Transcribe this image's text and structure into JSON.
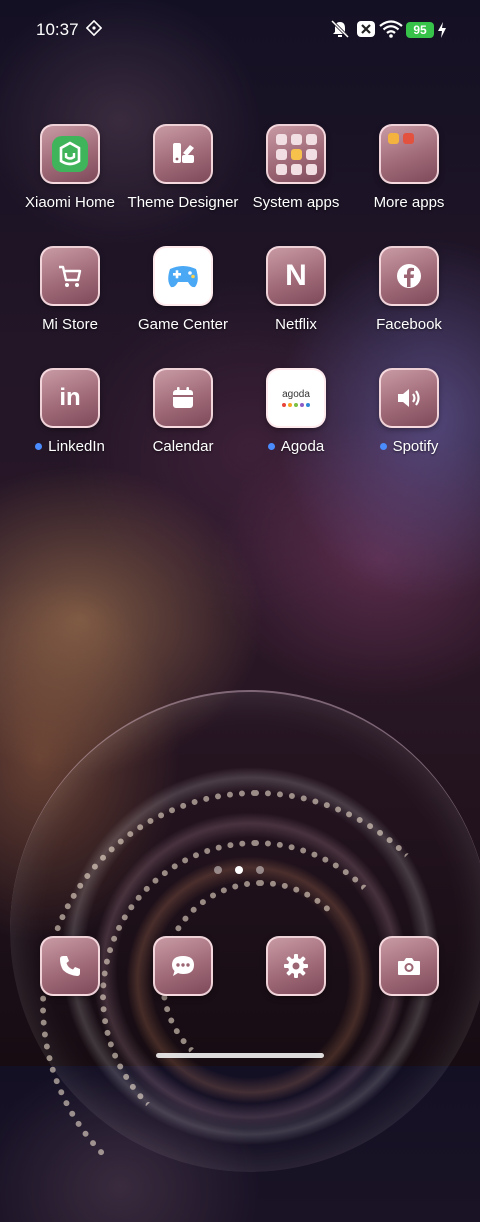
{
  "status_bar": {
    "time": "10:37",
    "battery_level": "95",
    "icons": [
      "nfc-icon",
      "mute-icon",
      "close-box-icon",
      "wifi-icon",
      "battery-icon",
      "charging-icon"
    ]
  },
  "apps": [
    {
      "label": "Xiaomi Home",
      "icon": "xiaomi-home-icon",
      "new": false
    },
    {
      "label": "Theme Designer",
      "icon": "theme-designer-icon",
      "new": false
    },
    {
      "label": "System apps",
      "icon": "folder-icon",
      "new": false
    },
    {
      "label": "More apps",
      "icon": "folder-icon",
      "new": false
    },
    {
      "label": "Mi Store",
      "icon": "cart-icon",
      "new": false
    },
    {
      "label": "Game Center",
      "icon": "gamepad-icon",
      "new": false
    },
    {
      "label": "Netflix",
      "icon": "netflix-icon",
      "new": false
    },
    {
      "label": "Facebook",
      "icon": "facebook-icon",
      "new": false
    },
    {
      "label": "LinkedIn",
      "icon": "linkedin-icon",
      "new": true
    },
    {
      "label": "Calendar",
      "icon": "calendar-icon",
      "new": false
    },
    {
      "label": "Agoda",
      "icon": "agoda-icon",
      "new": true
    },
    {
      "label": "Spotify",
      "icon": "speaker-icon",
      "new": true
    }
  ],
  "agoda_wordmark": "agoda",
  "dock": [
    {
      "icon": "phone-icon"
    },
    {
      "icon": "messages-icon"
    },
    {
      "icon": "settings-icon"
    },
    {
      "icon": "camera-icon"
    }
  ],
  "pages": {
    "count": 3,
    "active_index": 1
  },
  "colors": {
    "tile_gradient_top": "#c89aa4",
    "tile_gradient_bottom": "#7e4a5a",
    "badge_dot": "#4a8cff",
    "battery": "#37c24a"
  }
}
